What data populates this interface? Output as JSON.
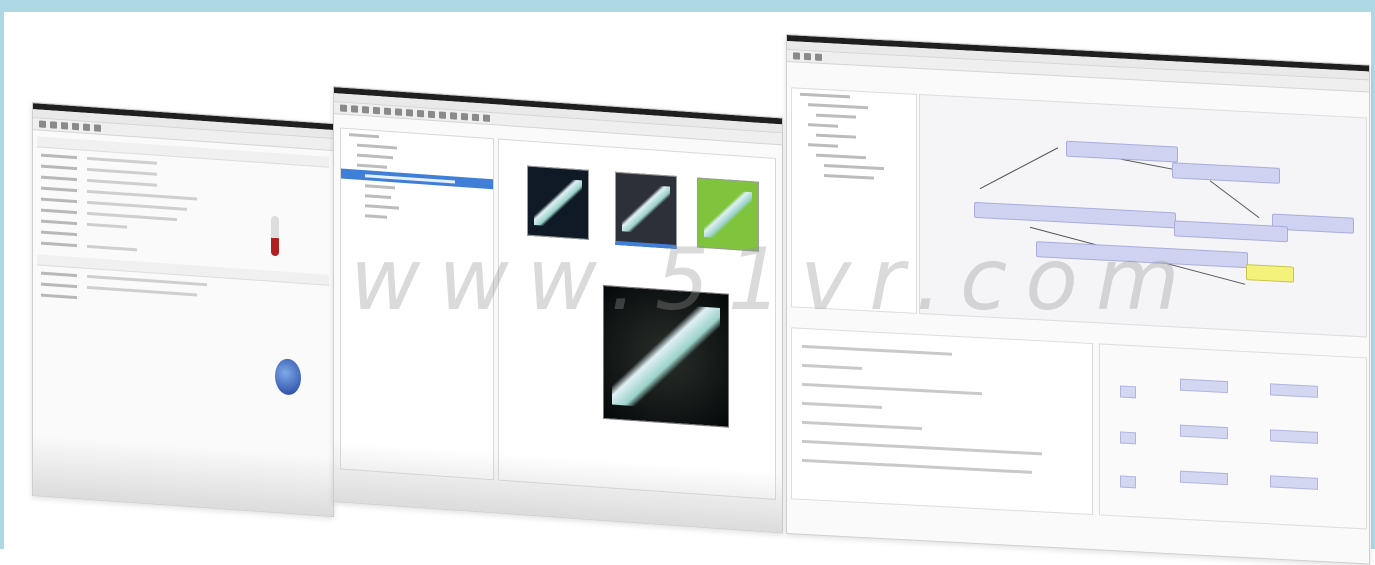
{
  "watermark": {
    "text": "www.51vr.com"
  },
  "colors": {
    "frame": "#aed8e4",
    "selection": "#3f7fd8",
    "graph_node": "#cfd2f0",
    "graph_node_highlight": "#f4f27a",
    "thumb_green": "#7fc43c"
  },
  "windows": [
    {
      "id": "properties-window",
      "icons": [
        "thermometer-icon",
        "globe-icon"
      ]
    },
    {
      "id": "image-browser-window",
      "icons": [
        "folder-icon",
        "image-thumbnail"
      ]
    },
    {
      "id": "graph-editor-window",
      "icons": [
        "node-graph-icon"
      ]
    }
  ]
}
